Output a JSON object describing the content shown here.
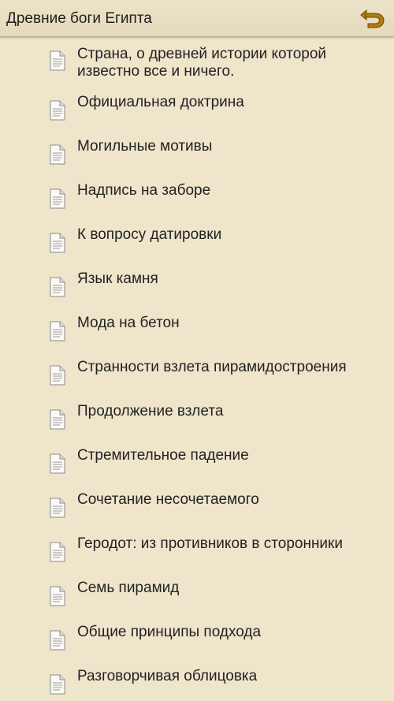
{
  "header": {
    "title": "Древние боги Египта",
    "back_icon": "back-arrow-icon",
    "accent_color": "#b07c10"
  },
  "chapters": [
    {
      "label": "Страна, о древней истории которой известно все и ничего.",
      "icon": "document-icon"
    },
    {
      "label": "Официальная доктрина",
      "icon": "document-icon"
    },
    {
      "label": "Могильные мотивы",
      "icon": "document-icon"
    },
    {
      "label": "Надпись на заборе",
      "icon": "document-icon"
    },
    {
      "label": "К вопросу датировки",
      "icon": "document-icon"
    },
    {
      "label": "Язык камня",
      "icon": "document-icon"
    },
    {
      "label": "Мода на бетон",
      "icon": "document-icon"
    },
    {
      "label": "Странности взлета пирамидостроения",
      "icon": "document-icon"
    },
    {
      "label": "Продолжение взлета",
      "icon": "document-icon"
    },
    {
      "label": "Стремительное падение",
      "icon": "document-icon"
    },
    {
      "label": "Сочетание несочетаемого",
      "icon": "document-icon"
    },
    {
      "label": "Геродот: из противников в сторонники",
      "icon": "document-icon"
    },
    {
      "label": "Семь пирамид",
      "icon": "document-icon"
    },
    {
      "label": "Общие принципы подхода",
      "icon": "document-icon"
    },
    {
      "label": "Разговорчивая облицовка",
      "icon": "document-icon"
    }
  ]
}
